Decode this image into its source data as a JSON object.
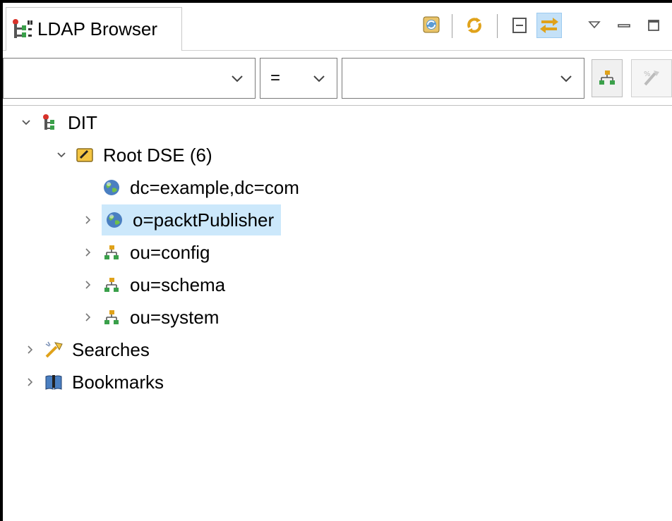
{
  "tab": {
    "title": "LDAP Browser",
    "icon": "ldap-browser-icon"
  },
  "toolbar": {
    "buttons": [
      {
        "name": "refresh-connections-icon"
      },
      {
        "name": "link-sync-icon"
      },
      {
        "name": "collapse-all-icon"
      },
      {
        "name": "link-with-editor-icon",
        "active": true
      },
      {
        "name": "view-menu-icon"
      },
      {
        "name": "minimize-icon"
      },
      {
        "name": "maximize-icon"
      }
    ]
  },
  "filter": {
    "attribute_value": "",
    "operator_value": "=",
    "filter_value": "",
    "buttons": [
      "quick-search-icon",
      "run-search-icon"
    ]
  },
  "tree": {
    "nodes": [
      {
        "label": "DIT",
        "icon": "dit-icon",
        "level": 0,
        "expanded": true
      },
      {
        "label": "Root DSE (6)",
        "icon": "root-dse-icon",
        "level": 1,
        "expanded": true
      },
      {
        "label": "dc=example,dc=com",
        "icon": "globe-icon",
        "level": 2,
        "has_children": false
      },
      {
        "label": "o=packtPublisher",
        "icon": "globe-icon",
        "level": 2,
        "has_children": true,
        "selected": true
      },
      {
        "label": "ou=config",
        "icon": "org-unit-icon",
        "level": 2,
        "has_children": true
      },
      {
        "label": "ou=schema",
        "icon": "org-unit-icon",
        "level": 2,
        "has_children": true
      },
      {
        "label": "ou=system",
        "icon": "org-unit-icon",
        "level": 2,
        "has_children": true
      },
      {
        "label": "Searches",
        "icon": "search-wand-icon",
        "level": 0,
        "has_children": true
      },
      {
        "label": "Bookmarks",
        "icon": "bookmarks-icon",
        "level": 0,
        "has_children": true
      }
    ]
  },
  "colors": {
    "selection": "#cce8fb",
    "active_toggle": "#c4e1f8",
    "border": "#7a7a7a"
  }
}
